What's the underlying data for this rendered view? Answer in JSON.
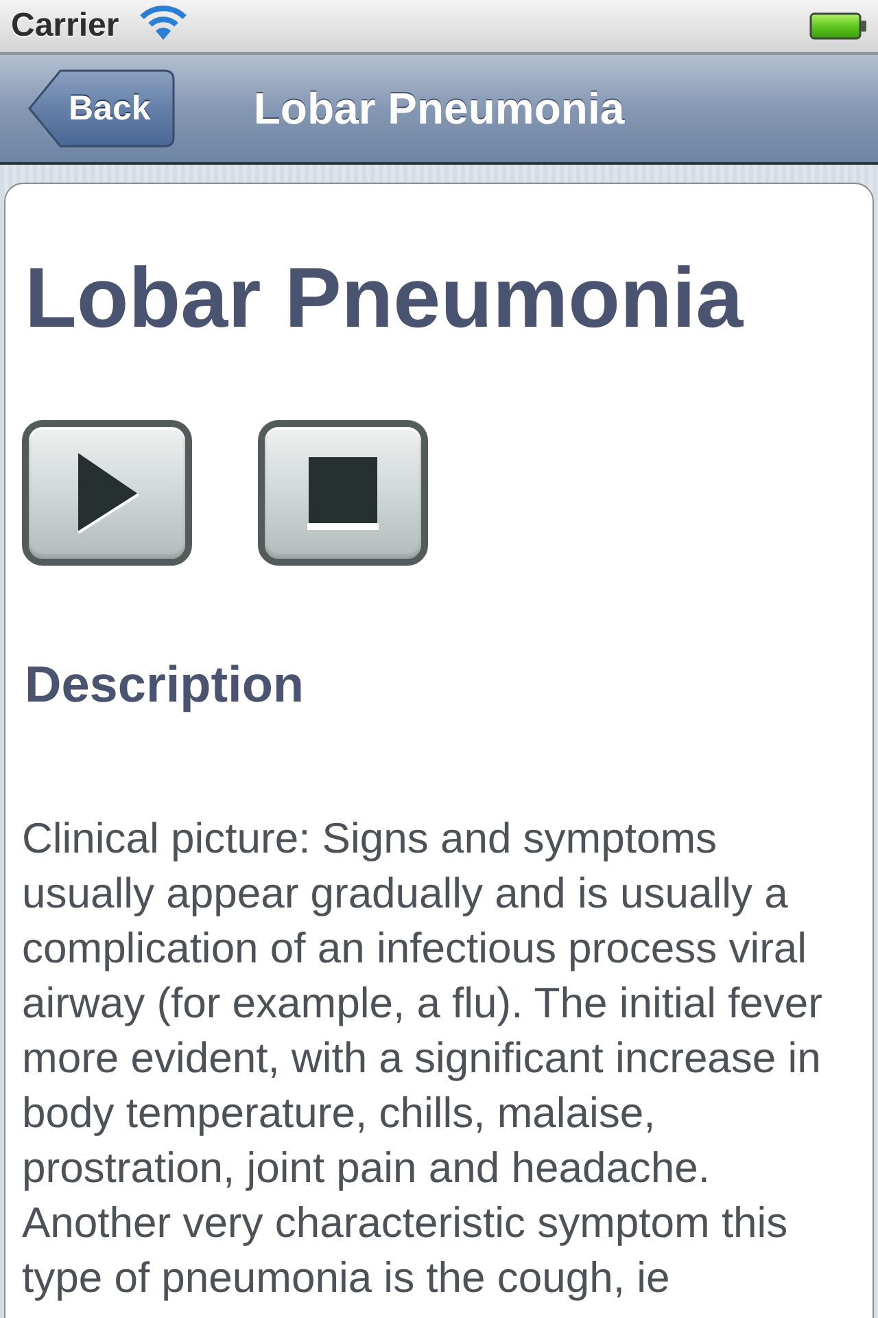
{
  "status_bar": {
    "carrier": "Carrier"
  },
  "nav_bar": {
    "back_button": "Back",
    "title": "Lobar Pneumonia"
  },
  "content": {
    "title": "Lobar Pneumonia",
    "media_controls": [
      {
        "kind": "play"
      },
      {
        "kind": "stop"
      }
    ],
    "section_heading": "Description",
    "paragraph": "Clinical picture: Signs and symptoms usually appear gradually and is usually a complication of an infectious process viral airway (for example, a flu). The initial fever more evident, with a significant increase in body temperature, chills, malaise, prostration, joint pain and headache. Another very characteristic symptom this type of pneumonia is the cough, ie"
  }
}
